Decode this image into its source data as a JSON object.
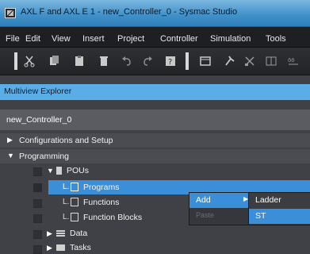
{
  "window": {
    "title": "AXL F and AXL E 1 - new_Controller_0 - Sysmac Studio"
  },
  "menubar": {
    "items": [
      "File",
      "Edit",
      "View",
      "Insert",
      "Project",
      "Controller",
      "Simulation",
      "Tools"
    ]
  },
  "toolbar": {
    "icons": [
      "cut-icon",
      "copy-icon",
      "paste-icon",
      "delete-icon",
      "undo-icon",
      "redo-icon",
      "help-icon",
      "window-icon",
      "build-icon",
      "cross-reference-icon",
      "compare-icon",
      "grid-icon"
    ]
  },
  "panel": {
    "title": "Multiview Explorer",
    "controller": "new_Controller_0"
  },
  "tree": {
    "configurations": "Configurations and Setup",
    "programming": "Programming",
    "pous": "POUs",
    "programs": "Programs",
    "functions": "Functions",
    "function_blocks": "Function Blocks",
    "data": "Data",
    "tasks": "Tasks"
  },
  "context_menu": {
    "add": "Add",
    "paste": "Paste"
  },
  "submenu": {
    "ladder": "Ladder",
    "st": "ST"
  },
  "colors": {
    "selection": "#3b8fd9",
    "panel_header": "#5aaee8",
    "background": "#3f4146"
  }
}
